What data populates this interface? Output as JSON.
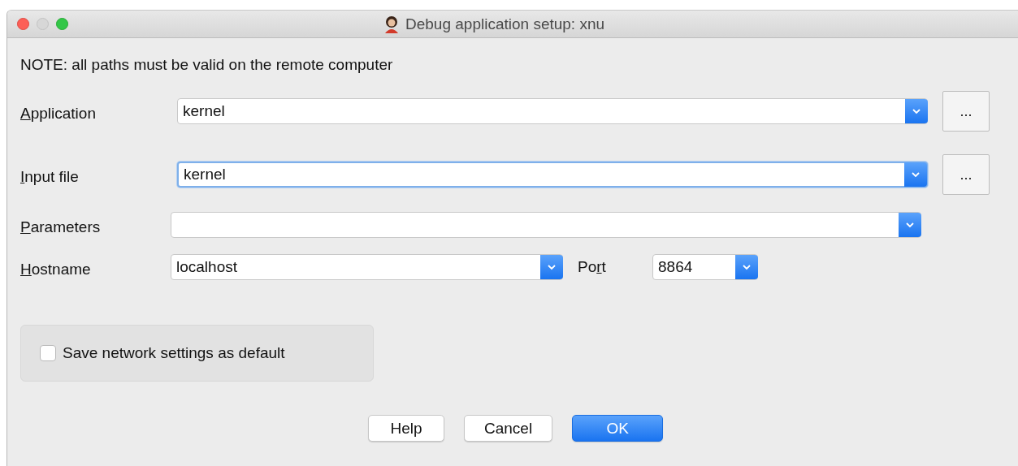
{
  "window": {
    "title": "Debug application setup: xnu"
  },
  "note": "NOTE: all paths must be valid on the remote computer",
  "fields": [
    {
      "label": [
        {
          "text": "A",
          "underlined": true
        },
        {
          "text": "pplication",
          "underlined": false
        }
      ],
      "value": "kernel",
      "focused": false,
      "browse": "..."
    },
    {
      "label": [
        {
          "text": "I",
          "underlined": true
        },
        {
          "text": "nput file",
          "underlined": false
        }
      ],
      "value": "kernel",
      "focused": true,
      "browse": "..."
    },
    {
      "label": [
        {
          "text": "P",
          "underlined": true
        },
        {
          "text": "arameters",
          "underlined": false
        }
      ],
      "focused": false
    }
  ],
  "host": {
    "label": [
      {
        "text": "H",
        "underlined": true
      },
      {
        "text": "ostname",
        "underlined": false
      }
    ],
    "value": "localhost",
    "focused": false
  },
  "port": {
    "label": [
      {
        "text": "Po",
        "underlined": false
      },
      {
        "text": "r",
        "underlined": true
      },
      {
        "text": "t",
        "underlined": false
      }
    ],
    "value": "8864",
    "focused": false
  },
  "save_default": {
    "label": "Save network settings as default",
    "checked": false
  },
  "buttons": [
    {
      "label": "Help",
      "default": false
    },
    {
      "label": "Cancel",
      "default": false
    },
    {
      "label": "OK",
      "default": true
    }
  ]
}
